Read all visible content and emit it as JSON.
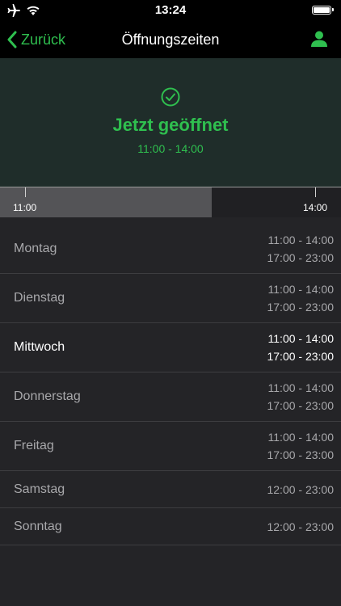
{
  "status_bar": {
    "time": "13:24",
    "icons": [
      "airplane-icon",
      "wifi-icon",
      "battery-icon"
    ]
  },
  "nav": {
    "back_label": "Zurück",
    "title": "Öffnungszeiten",
    "profile_icon": "person-icon"
  },
  "status_card": {
    "icon": "check-circle-icon",
    "headline": "Jetzt geöffnet",
    "range": "11:00 - 14:00",
    "accent_color": "#2fbf4f"
  },
  "timeline": {
    "start_label": "11:00",
    "end_label": "14:00",
    "progress_fraction": 0.62
  },
  "schedule": [
    {
      "day": "Montag",
      "hours": [
        "11:00 - 14:00",
        "17:00 - 23:00"
      ],
      "today": false
    },
    {
      "day": "Dienstag",
      "hours": [
        "11:00 - 14:00",
        "17:00 - 23:00"
      ],
      "today": false
    },
    {
      "day": "Mittwoch",
      "hours": [
        "11:00 - 14:00",
        "17:00 - 23:00"
      ],
      "today": true
    },
    {
      "day": "Donnerstag",
      "hours": [
        "11:00 - 14:00",
        "17:00 - 23:00"
      ],
      "today": false
    },
    {
      "day": "Freitag",
      "hours": [
        "11:00 - 14:00",
        "17:00 - 23:00"
      ],
      "today": false
    },
    {
      "day": "Samstag",
      "hours": [
        "12:00 - 23:00"
      ],
      "today": false
    },
    {
      "day": "Sonntag",
      "hours": [
        "12:00 - 23:00"
      ],
      "today": false
    }
  ]
}
